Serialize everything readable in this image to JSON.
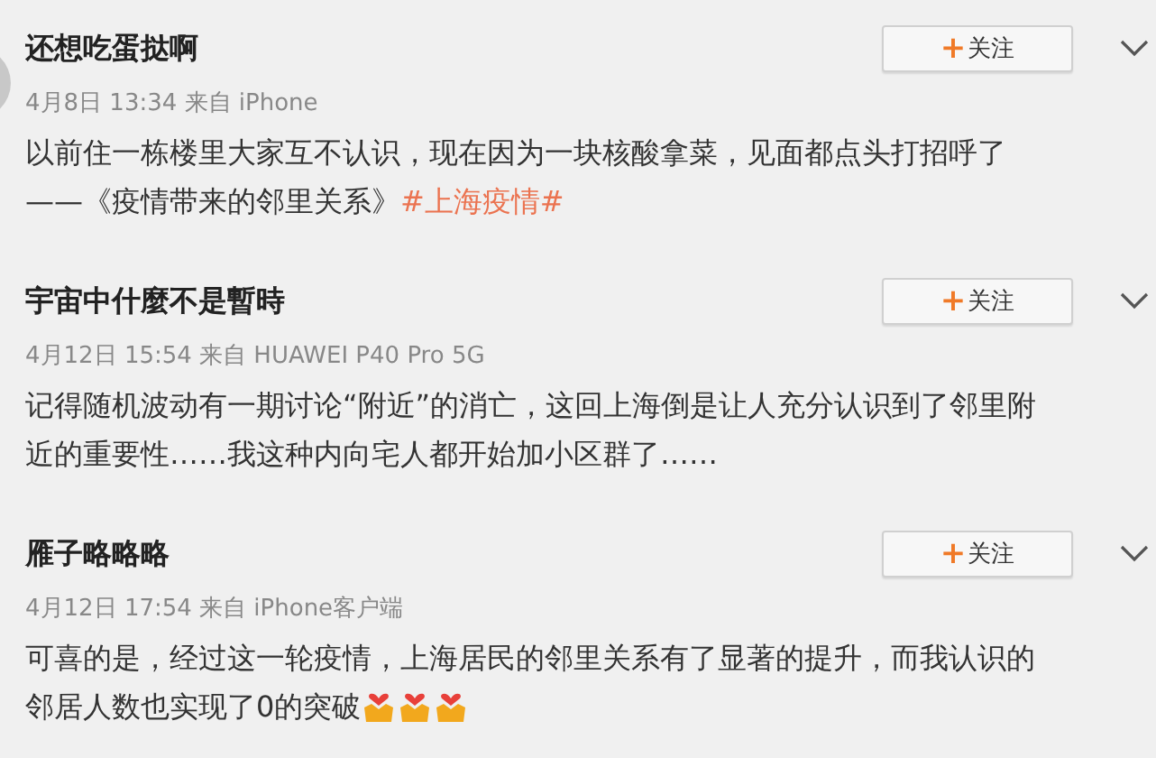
{
  "posts": [
    {
      "author": "还想吃蛋挞啊",
      "has_avatar": true,
      "follow_button": {
        "plus": "+",
        "label": "关注"
      },
      "meta": "4月8日 13:34 来自 iPhone",
      "lines": [
        [
          {
            "kind": "text",
            "text": "以前住一栋楼里大家互不认识，现在因为一块核酸拿菜，见面都点头打招呼了"
          }
        ],
        [
          {
            "kind": "text",
            "text": "——《疫情带来的邻里关系》"
          },
          {
            "kind": "hashtag",
            "text": "#上海疫情#"
          }
        ]
      ]
    },
    {
      "author": "宇宙中什麼不是暫時",
      "has_avatar": false,
      "follow_button": {
        "plus": "+",
        "label": "关注"
      },
      "meta": "4月12日 15:54 来自 HUAWEI P40 Pro 5G",
      "lines": [
        [
          {
            "kind": "text",
            "text": "记得随机波动有一期讨论“附近”的消亡，这回上海倒是让人充分认识到了邻里附"
          }
        ],
        [
          {
            "kind": "text",
            "text": "近的重要性……我这种内向宅人都开始加小区群了……"
          }
        ]
      ]
    },
    {
      "author": "雁子略略略",
      "has_avatar": false,
      "follow_button": {
        "plus": "+",
        "label": "关注"
      },
      "meta": "4月12日 17:54 来自 iPhone客户端",
      "lines": [
        [
          {
            "kind": "text",
            "text": "可喜的是，经过这一轮疫情，上海居民的邻里关系有了显著的提升，而我认识的"
          }
        ],
        [
          {
            "kind": "text",
            "text": "邻居人数也实现了0的突破"
          },
          {
            "kind": "emoji"
          },
          {
            "kind": "emoji"
          },
          {
            "kind": "emoji"
          }
        ]
      ]
    }
  ]
}
